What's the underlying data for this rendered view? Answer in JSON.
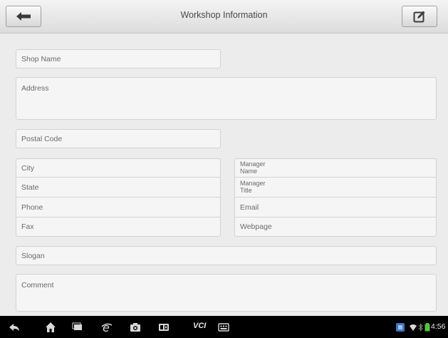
{
  "header": {
    "title": "Workshop Information"
  },
  "form": {
    "shop_name": "Shop Name",
    "address": "Address",
    "postal_code": "Postal Code",
    "city": "City",
    "state": "State",
    "phone": "Phone",
    "fax": "Fax",
    "manager_name": "Manager\nName",
    "manager_title": "Manager\nTitle",
    "email": "Email",
    "webpage": "Webpage",
    "slogan": "Slogan",
    "comment": "Comment"
  },
  "navbar": {
    "vci_label": "VCI",
    "time": "4:56",
    "icons": [
      "back-icon",
      "home-icon",
      "recent-apps-icon",
      "browser-icon",
      "camera-icon",
      "screen-capture-icon",
      "vci-icon",
      "keyboard-icon",
      "app-notification-icon",
      "wifi-icon",
      "bluetooth-icon",
      "battery-icon"
    ]
  },
  "colors": {
    "background": "#ececec",
    "field_bg": "#f5f5f5",
    "field_border": "#d2d2d2",
    "navbar": "#000000"
  }
}
